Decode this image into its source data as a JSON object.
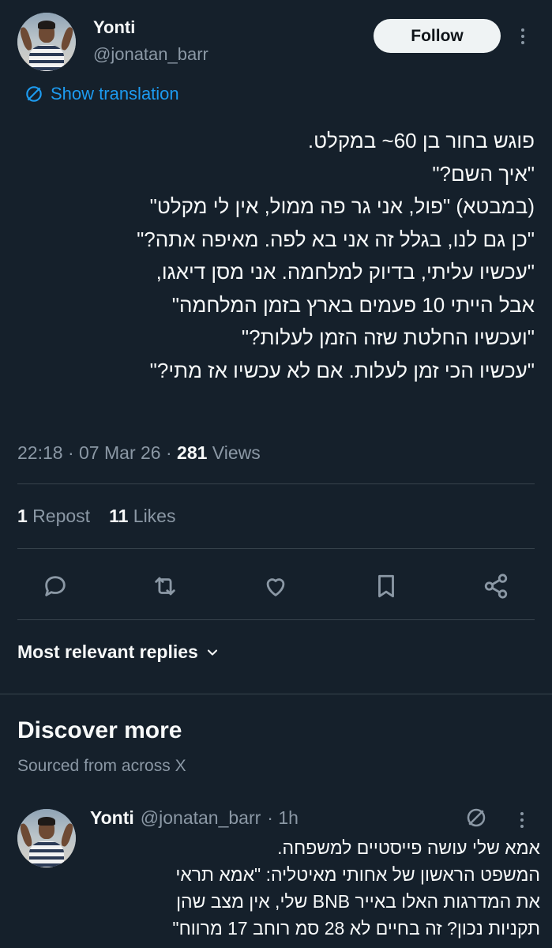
{
  "author": {
    "name": "Yonti",
    "handle": "@jonatan_barr"
  },
  "follow_label": "Follow",
  "show_translation": "Show translation",
  "tweet_lines": [
    "פוגש בחור בן 60~ במקלט.",
    "\"איך השם?\"",
    "(במבטא) \"פול, אני גר פה ממול, אין לי מקלט\"",
    "\"כן גם לנו, בגלל זה אני בא לפה. מאיפה אתה?\"",
    "\"עכשיו עליתי, בדיוק למלחמה. אני מסן דיאגו,",
    "אבל הייתי 10 פעמים בארץ בזמן המלחמה\"",
    "\"ועכשיו החלטת שזה הזמן לעלות?\"",
    "\"עכשיו הכי זמן לעלות. אם לא עכשיו אז מתי?\""
  ],
  "meta": {
    "time": "22:18",
    "date": "07 Mar 26",
    "sep": " · ",
    "views_count": "281",
    "views_label": " Views"
  },
  "stats": {
    "reposts_count": "1",
    "reposts_label": " Repost",
    "likes_count": "11",
    "likes_label": " Likes"
  },
  "actions": [
    "reply-icon",
    "retweet-icon",
    "like-icon",
    "bookmark-icon",
    "share-icon"
  ],
  "replies_sort_label": "Most relevant replies",
  "discover": {
    "title": "Discover more",
    "subtitle": "Sourced from across X"
  },
  "reply": {
    "name": "Yonti",
    "handle": "@jonatan_barr",
    "time": "· 1h",
    "lines": [
      "אמא שלי עושה פייסטיים למשפחה.",
      "המשפט הראשון של אחותי מאיטליה: \"אמא תראי",
      "את המדרגות האלו באייר BNB שלי, אין מצב שהן",
      "תקניות נכון? זה בחיים לא 28 סמ רוחב 17 מרווח\""
    ]
  },
  "colors": {
    "background": "#15202b",
    "accent": "#1d9bf0",
    "secondary_text": "#8b98a5",
    "divider": "#38444d"
  }
}
